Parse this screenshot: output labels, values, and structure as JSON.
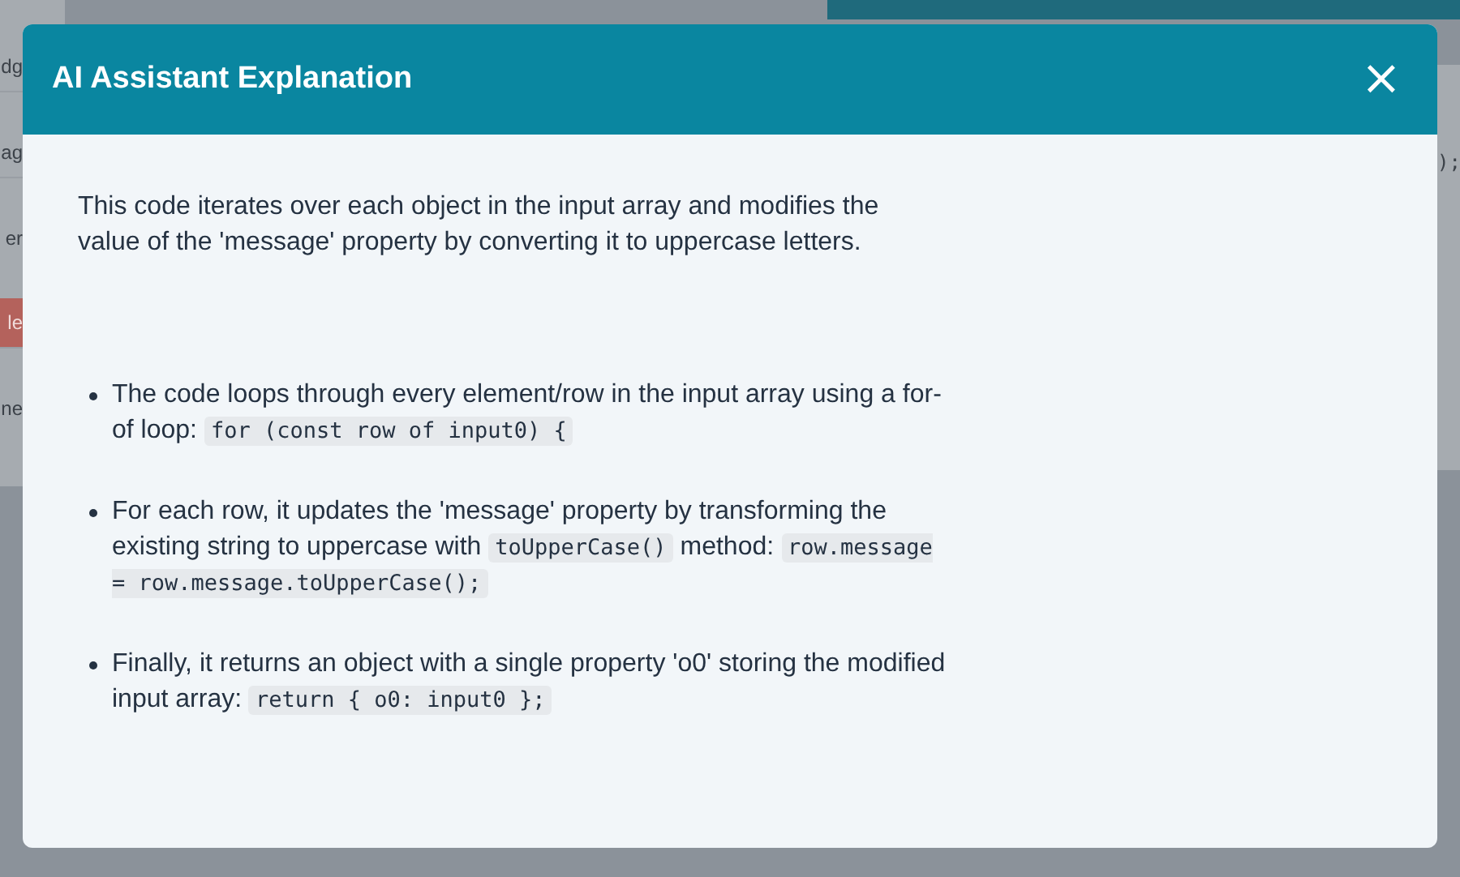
{
  "background": {
    "left_fragments": [
      {
        "text": "dg",
        "kind": "field"
      },
      {
        "text": "ag",
        "kind": "field"
      },
      {
        "text": "er",
        "kind": "label"
      },
      {
        "text": "le",
        "kind": "danger"
      },
      {
        "text": "ne",
        "kind": "label"
      }
    ],
    "right_fragment": ");"
  },
  "dialog": {
    "title": "AI Assistant Explanation",
    "close": "×",
    "intro": "This code iterates over each object in the input array and modifies the value of the 'message' property by converting it to uppercase letters.",
    "bullets": [
      [
        {
          "kind": "text",
          "text": "The code loops through every element/row in the input array using a for-of loop: "
        },
        {
          "kind": "code",
          "text": "for (const row of input0) {"
        }
      ],
      [
        {
          "kind": "text",
          "text": "For each row, it updates the 'message' property by transforming the existing string to uppercase with "
        },
        {
          "kind": "code",
          "text": "toUpperCase()"
        },
        {
          "kind": "text",
          "text": " method: "
        },
        {
          "kind": "code",
          "text": "row.message = row.message.toUpperCase();"
        }
      ],
      [
        {
          "kind": "text",
          "text": "Finally, it returns an object with a single property 'o0' storing the modified input array: "
        },
        {
          "kind": "code",
          "text": "return { o0: input0 };"
        }
      ]
    ]
  }
}
